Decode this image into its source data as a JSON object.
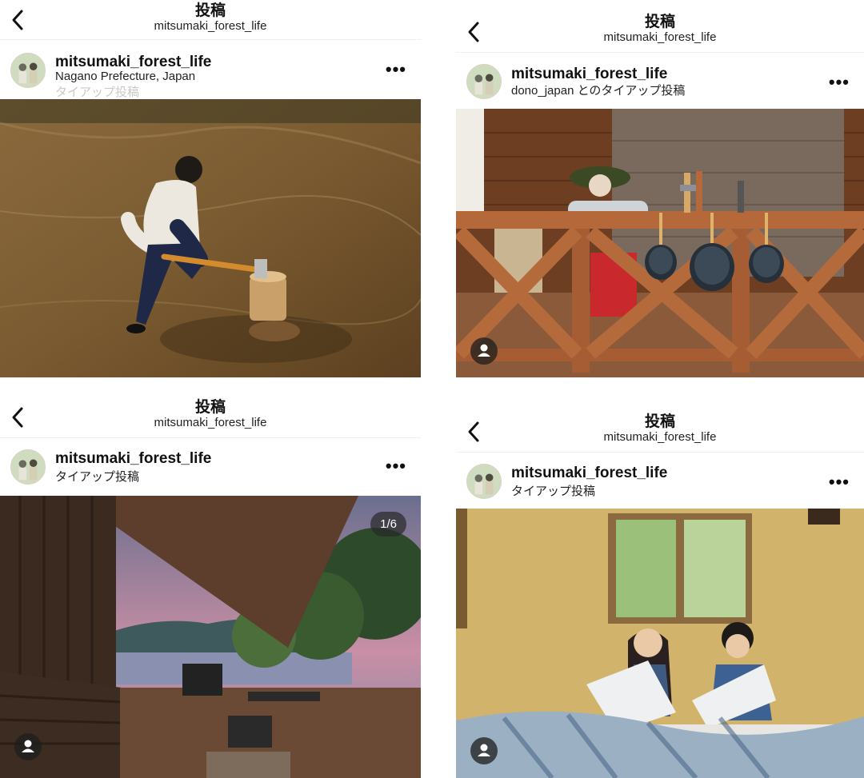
{
  "panels": [
    {
      "header": {
        "title": "投稿",
        "subtitle": "mitsumaki_forest_life"
      },
      "post": {
        "username": "mitsumaki_forest_life",
        "line1": "Nagano Prefecture, Japan",
        "line2": "タイアップ投稿"
      },
      "photo": {
        "subject": "man-splitting-wood-with-axe"
      }
    },
    {
      "header": {
        "title": "投稿",
        "subtitle": "mitsumaki_forest_life"
      },
      "post": {
        "username": "mitsumaki_forest_life",
        "line1": "dono_japan とのタイアップ投稿"
      },
      "photo": {
        "subject": "wooden-deck-with-hanging-frying-pans"
      }
    },
    {
      "header": {
        "title": "投稿",
        "subtitle": "mitsumaki_forest_life"
      },
      "post": {
        "username": "mitsumaki_forest_life",
        "line1": "タイアップ投稿"
      },
      "photo": {
        "subject": "cabin-terrace-lake-sunset",
        "counter": "1/6"
      }
    },
    {
      "header": {
        "title": "投稿",
        "subtitle": "mitsumaki_forest_life"
      },
      "post": {
        "username": "mitsumaki_forest_life",
        "line1": "タイアップ投稿"
      },
      "photo": {
        "subject": "couple-on-bed-with-mattress-toppers"
      }
    }
  ],
  "icons": {
    "back": "chevron-left-icon",
    "more": "more-horizontal-icon",
    "tag": "person-tag-icon"
  },
  "colors": {
    "text": "#111111",
    "divider": "#efefef",
    "faint": "#c9c9c9"
  }
}
